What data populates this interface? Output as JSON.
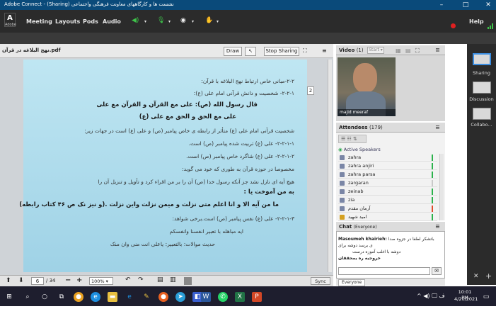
{
  "window": {
    "title": "Adobe Connect - (Sharing) نشست ها و کارگاههای معاونت فرهنگی واجتماعی",
    "minimize": "–",
    "maximize": "□",
    "close": "✕"
  },
  "menu": {
    "logo": "Adobe",
    "items": [
      "Meeting",
      "Layouts",
      "Pods",
      "Audio"
    ],
    "help": "Help"
  },
  "share_pod": {
    "filename": "نهج البلاغه در قرآن.pdf",
    "draw_label": "Draw",
    "stop_sharing_label": "Stop Sharing",
    "page_current": "6",
    "page_total": "/ 34",
    "zoom": "100%",
    "sync_label": "Sync",
    "side_page_number": "2",
    "lines": [
      "۲-۲-مبانی خاص ارتباط نهج البلاغه با قرآن:",
      "۲-۲-۱- شخصیت و دانش قرآنی امام علی (ع):",
      "قال رسول الله (ص): علی مع القرآن و القرآن مع علی",
      "علی مع الحق و الحق مع علی (ع)",
      "شخصیت قرآنی امام علی (ع) متأثر از رابطه ی خاص پیامبر (ص) و علی (ع) است در جهات زیر:",
      "۲-۲-۱-۱- علی (ع) تربیت شده پیامبر (ص) است.",
      "۲-۲-۱-۲- علی (ع) شاگرد خاص پیامبر (ص) است.",
      "مخصوصا در حوزه قرآن به طوری که خود می گوید:",
      "هیچ آیه ای نازل نشد جز آنکه رسول خدا (ص) آن را بر من اقراء کرد و تأویل و تنزیل آن را",
      "به من آموخت یا :",
      "ما من آیه الا و انا اعلم متی نزلت و میمن نزلت واین نزلت .(و نیز نک ص ۴۶ کتاب رابطه)",
      "۲-۲-۱-۳- علی (ع) نفس پیامبر (ص) است.برخی شواهد:",
      "ایه مباهله با تعبیر انفسنا وانفسکم",
      "حدیث موالات: بالتعبیر: یاعلی انت منی وان منک"
    ]
  },
  "video_pod": {
    "title": "Video",
    "count": "(1)",
    "start_label": "Start",
    "speaker_name": "majid meeraf"
  },
  "attendees_pod": {
    "title": "Attendees",
    "count": "(179)",
    "section_label": "Active Speakers",
    "names": [
      "zahra",
      "zahra anjiri",
      "zahra parsa",
      "zargaran",
      "zeinab",
      "zia",
      "آرمان مقدم",
      "امید شهید"
    ]
  },
  "chat_pod": {
    "title": "Chat",
    "scope": "(Everyone)",
    "message_author": "Masoumeh khairieh:",
    "message_text": "باتشکر لطفا در جزوه صدا ی برسد دوشه برای",
    "message_text2": "دوشه با اغلب آموزه درست",
    "message_text3": "خروجیه ره یمحققان",
    "recipient_tab": "Everyone"
  },
  "sidebar": {
    "items": [
      "Sharing",
      "Discussion",
      "Collabo..."
    ]
  },
  "taskbar": {
    "time": "10:01 PM",
    "date": "4/20/2021"
  }
}
